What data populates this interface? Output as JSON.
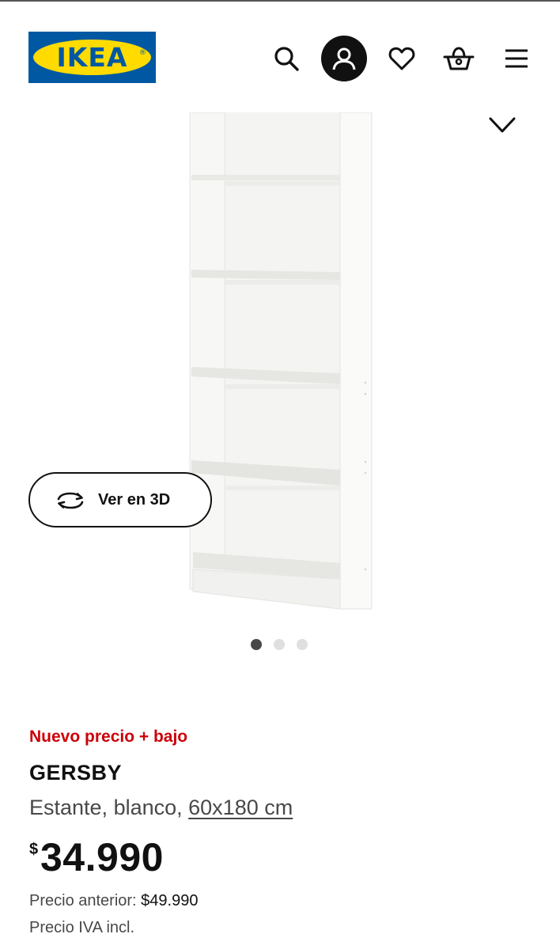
{
  "header": {
    "logo_text": "IKEA",
    "logo_registered": "®",
    "colors": {
      "brand_blue": "#0058a3",
      "brand_yellow": "#ffdb00"
    },
    "icons": [
      "search-icon",
      "account-icon",
      "heart-icon",
      "basket-icon",
      "menu-icon"
    ]
  },
  "gallery": {
    "image_alt": "GERSBY bookcase, white",
    "view_3d_label": "Ver en 3D",
    "favorite_icon": "heart-icon",
    "slides_total": 3,
    "active_slide": 1
  },
  "product": {
    "badge": "Nuevo precio + bajo",
    "name": "GERSBY",
    "description_prefix": "Estante, blanco, ",
    "dimensions": "60x180 cm",
    "currency_symbol": "$",
    "price": "34.990",
    "previous_price_label": "Precio anterior: ",
    "previous_price": "$49.990",
    "tax_note": "Precio IVA incl.",
    "colors": {
      "badge": "#cc0008",
      "text": "#111111",
      "secondary": "#484848"
    }
  }
}
